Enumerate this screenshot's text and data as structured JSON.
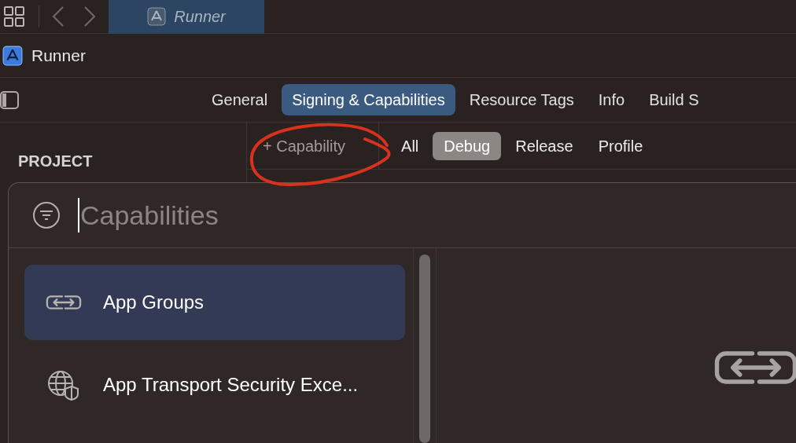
{
  "editor_tab": {
    "title": "Runner",
    "selected": true
  },
  "target": {
    "name": "Runner"
  },
  "tabs": [
    {
      "label": "General",
      "selected": false
    },
    {
      "label": "Signing & Capabilities",
      "selected": true
    },
    {
      "label": "Resource Tags",
      "selected": false
    },
    {
      "label": "Info",
      "selected": false
    },
    {
      "label": "Build S",
      "selected": false
    }
  ],
  "sidebar": {
    "heading": "PROJECT"
  },
  "add_capability": {
    "label": "+ Capability"
  },
  "configurations": [
    {
      "label": "All",
      "selected": false
    },
    {
      "label": "Debug",
      "selected": true
    },
    {
      "label": "Release",
      "selected": false
    },
    {
      "label": "Profile",
      "selected": false
    }
  ],
  "capability_picker": {
    "search": {
      "placeholder": "Capabilities"
    },
    "items": [
      {
        "label": "App Groups",
        "kind": "link",
        "selected": true
      },
      {
        "label": "App Transport Security Exce...",
        "kind": "globe",
        "selected": false
      }
    ]
  }
}
